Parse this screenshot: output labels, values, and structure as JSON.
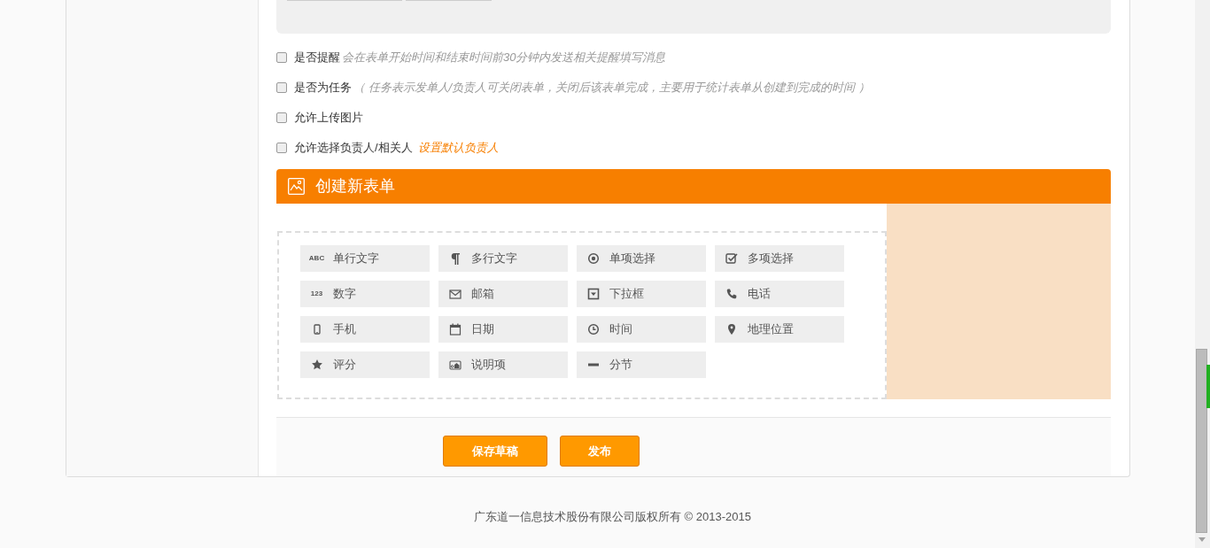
{
  "options": [
    {
      "label": "是否提醒",
      "checked": false,
      "note": "会在表单开始时间和结束时间前30分钟内发送相关提醒填写消息",
      "kind": "hint"
    },
    {
      "label": "是否为任务",
      "checked": false,
      "note": "（ 任务表示发单人/负责人可关闭表单，关闭后该表单完成，主要用于统计表单从创建到完成的时间 ）",
      "kind": "hint"
    },
    {
      "label": "允许上传图片",
      "checked": false
    },
    {
      "label": "允许选择负责人/相关人",
      "checked": false,
      "note": "设置默认负责人",
      "kind": "link"
    }
  ],
  "form_builder": {
    "title": "创建新表单",
    "fields": [
      {
        "label": "单行文字",
        "badge": "ABC",
        "kind": "badge"
      },
      {
        "label": "多行文字",
        "kind": "paragraph"
      },
      {
        "label": "单项选择",
        "kind": "radio"
      },
      {
        "label": "多项选择",
        "kind": "checkbox"
      },
      {
        "label": "数字",
        "badge": "123",
        "kind": "badge"
      },
      {
        "label": "邮箱",
        "kind": "envelope"
      },
      {
        "label": "下拉框",
        "kind": "dropdown"
      },
      {
        "label": "电话",
        "kind": "phone"
      },
      {
        "label": "手机",
        "kind": "mobile"
      },
      {
        "label": "日期",
        "kind": "calendar"
      },
      {
        "label": "时间",
        "kind": "clock"
      },
      {
        "label": "地理位置",
        "kind": "pin"
      },
      {
        "label": "评分",
        "kind": "star"
      },
      {
        "label": "说明项",
        "kind": "image"
      },
      {
        "label": "分节",
        "kind": "dash"
      }
    ]
  },
  "buttons": [
    {
      "label": "保存草稿"
    },
    {
      "label": "发布"
    }
  ],
  "footer": "广东道一信息技术股份有限公司版权所有 © 2013-2015"
}
